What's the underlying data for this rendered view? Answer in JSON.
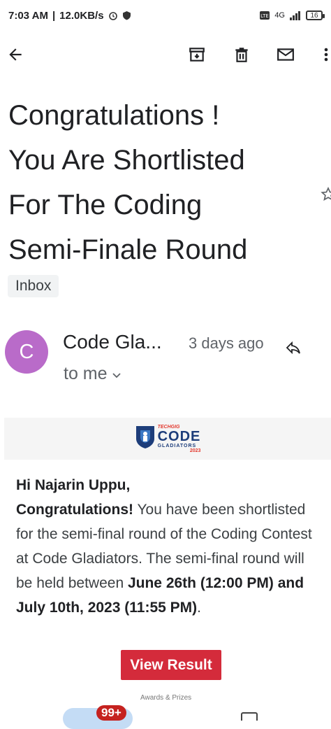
{
  "status_bar": {
    "time": "7:03 AM",
    "speed": "12.0KB/s",
    "network": "4G",
    "battery": "16"
  },
  "toolbar": {
    "back_icon": "arrow-left-icon",
    "archive_icon": "archive-icon",
    "delete_icon": "trash-icon",
    "mark_unread_icon": "mail-icon",
    "more_icon": "more-vert-icon"
  },
  "email": {
    "subject_lines": [
      "Congratulations !",
      "You Are Shortlisted",
      "For The Coding",
      "Semi-Finale Round"
    ],
    "label": "Inbox",
    "sender": {
      "initial": "C",
      "name": "Code Gla...",
      "time": "3 days ago",
      "recipient": "to me"
    },
    "banner": {
      "logo_small": "TECHGIG",
      "logo_main": "CODE",
      "logo_sub": "GLADIATORS",
      "logo_year": "2023"
    },
    "body": {
      "greeting": "Hi Najarin Uppu,",
      "congrats": "Congratulations!",
      "text1": " You have been shortlisted for the semi-final round of the Coding Contest at Code Gladiators. The semi-final round will be held between ",
      "bold1": "June 26th (12:00 PM) and July 10th, 2023 (11:55 PM)",
      "text2": "."
    },
    "button_label": "View Result",
    "footer_snippet": "Awards & Prizes"
  },
  "bottom_nav": {
    "badge": "99+"
  },
  "colors": {
    "avatar": "#b96bc9",
    "button": "#d42b3b",
    "badge": "#c5221f"
  }
}
